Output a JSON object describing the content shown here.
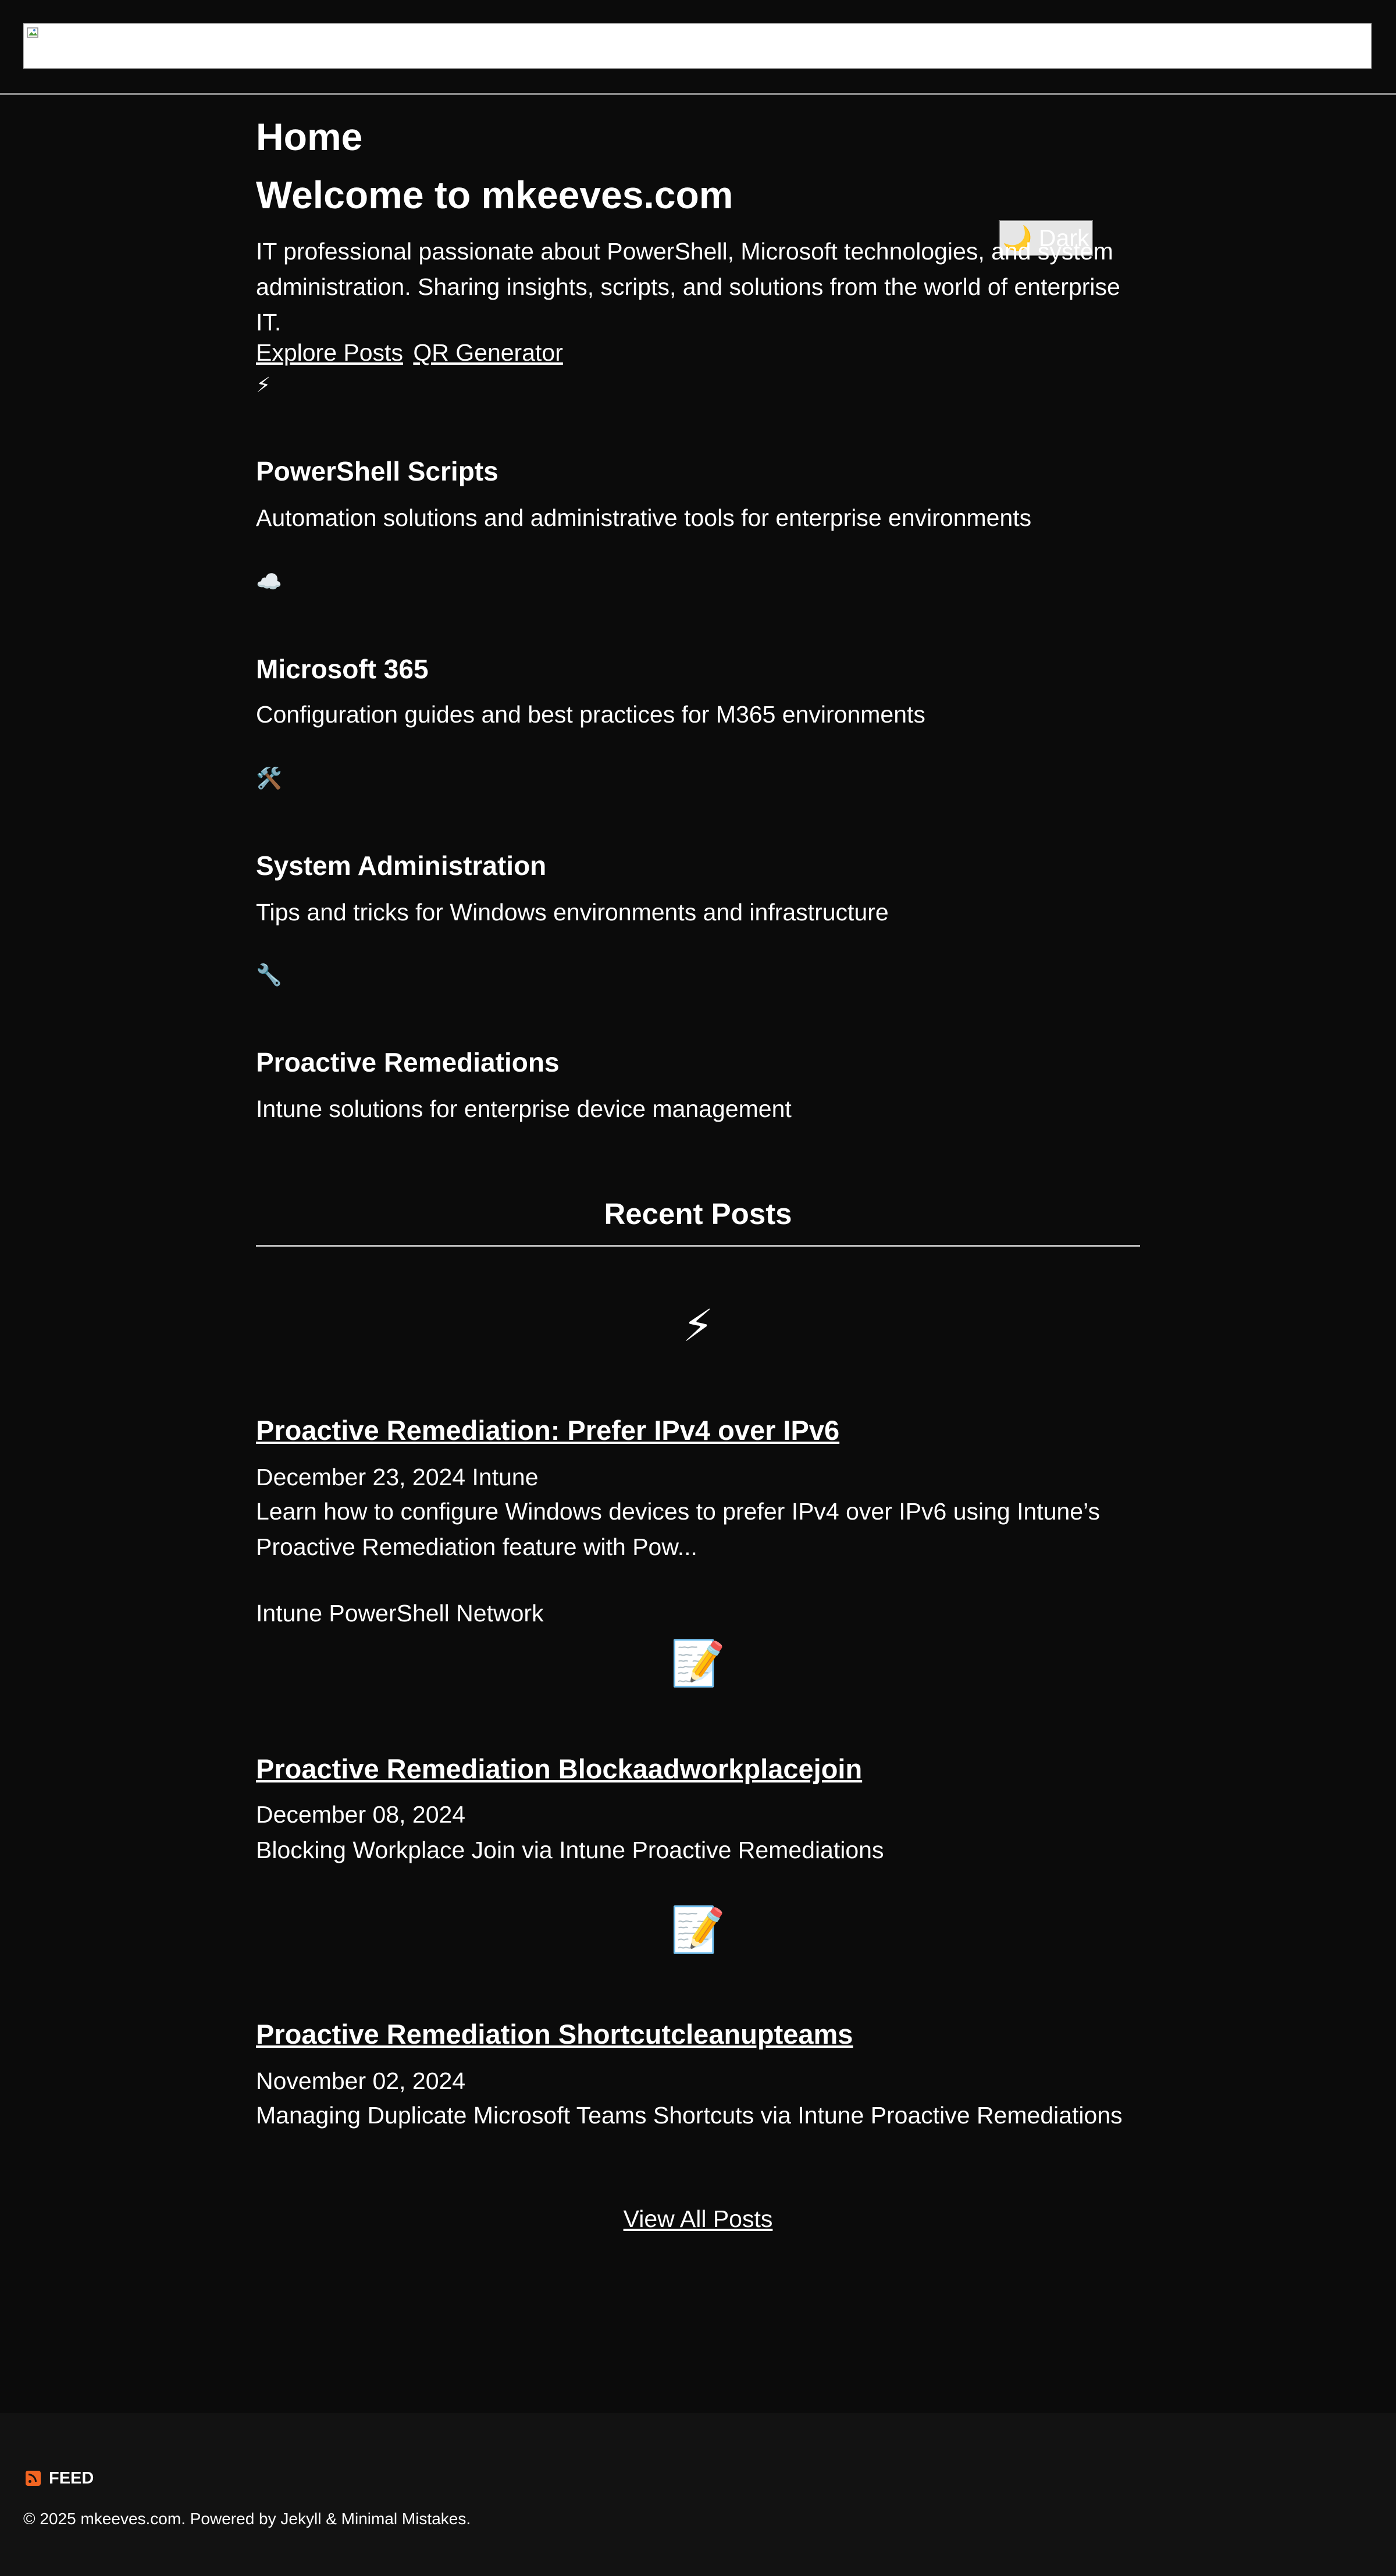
{
  "header": {
    "logo_alt": ""
  },
  "page": {
    "title": "Home",
    "welcome": "Welcome to mkeeves.com",
    "intro": "IT professional passionate about PowerShell, Microsoft technologies, and system administration. Sharing insights, scripts, and solutions from the world of enterprise IT.",
    "theme_toggle": "🌙 Dark",
    "links": [
      {
        "label": "Explore Posts"
      },
      {
        "label": "QR Generator"
      }
    ]
  },
  "categories": [
    {
      "icon": "⚡",
      "icon_name": "lightning-icon",
      "title": "PowerShell Scripts",
      "description": "Automation solutions and administrative tools for enterprise environments"
    },
    {
      "icon": "☁️",
      "icon_name": "cloud-icon",
      "title": "Microsoft 365",
      "description": "Configuration guides and best practices for M365 environments"
    },
    {
      "icon": "🛠️",
      "icon_name": "tools-icon",
      "title": "System Administration",
      "description": "Tips and tricks for Windows environments and infrastructure"
    },
    {
      "icon": "🔧",
      "icon_name": "wrench-icon",
      "title": "Proactive Remediations",
      "description": "Intune solutions for enterprise device management"
    }
  ],
  "recent": {
    "heading": "Recent Posts",
    "posts": [
      {
        "icon": "⚡",
        "icon_name": "lightning-icon",
        "title": "Proactive Remediation: Prefer IPv4 over IPv6",
        "meta": "December 23, 2024 Intune",
        "excerpt": "Learn how to configure Windows devices to prefer IPv4 over IPv6 using Intune’s Proactive Remediation feature with Pow...",
        "tags": "Intune PowerShell Network"
      },
      {
        "icon": "📝",
        "icon_name": "memo-icon",
        "title": "Proactive Remediation Blockaadworkplacejoin",
        "meta": "December 08, 2024",
        "excerpt": "Blocking Workplace Join via Intune Proactive Remediations",
        "tags": ""
      },
      {
        "icon": "📝",
        "icon_name": "memo-icon",
        "title": "Proactive Remediation Shortcutcleanupteams",
        "meta": "November 02, 2024",
        "excerpt": "Managing Duplicate Microsoft Teams Shortcuts via Intune Proactive Remediations",
        "tags": ""
      }
    ],
    "view_all": "View All Posts"
  },
  "footer": {
    "feed_label": "FEED",
    "copyright": "© 2025 mkeeves.com. Powered by Jekyll & Minimal Mistakes."
  }
}
